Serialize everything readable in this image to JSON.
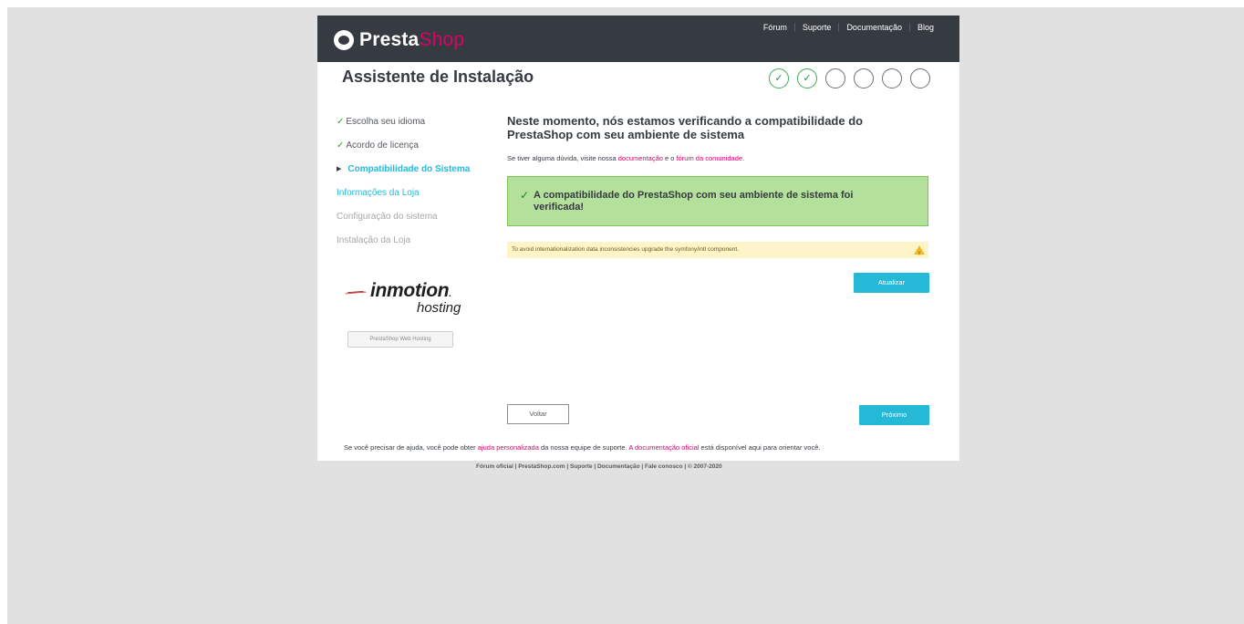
{
  "header": {
    "logo_presta": "Presta",
    "logo_shop": "Shop",
    "nav": [
      "Fórum",
      "Suporte",
      "Documentação",
      "Blog"
    ]
  },
  "title": "Assistente de Instalação",
  "steps": [
    {
      "state": "done",
      "symbol": "✓"
    },
    {
      "state": "done",
      "symbol": "✓"
    },
    {
      "state": "todo",
      "symbol": ""
    },
    {
      "state": "todo",
      "symbol": ""
    },
    {
      "state": "todo",
      "symbol": ""
    },
    {
      "state": "todo",
      "symbol": ""
    }
  ],
  "sidebar": {
    "items": [
      {
        "label": "Escolha seu idioma",
        "state": "done"
      },
      {
        "label": "Acordo de licença",
        "state": "done"
      },
      {
        "label": "Compatibilidade do Sistema",
        "state": "active"
      },
      {
        "label": "Informações da Loja",
        "state": "next"
      },
      {
        "label": "Configuração do sistema",
        "state": "todo"
      },
      {
        "label": "Instalação da Loja",
        "state": "todo"
      }
    ],
    "sponsor_word": "inmotion",
    "sponsor_sub": "hosting",
    "sponsor_button": "PrestaShop Web Hosting"
  },
  "main": {
    "heading": "Neste momento, nós estamos verificando a compatibilidade do PrestaShop com seu ambiente de sistema",
    "info_prefix": "Se tiver alguma dúvida, visite nossa ",
    "info_link1": "documentação",
    "info_mid": " e o ",
    "info_link2": "fórum da comunidade",
    "info_suffix": ".",
    "success_message": "A compatibilidade do PrestaShop com seu ambiente de sistema foi verificada!",
    "warning_message": "To avoid internationalization data inconsistencies upgrade the symfony/intl component.",
    "update_button": "Atualizar",
    "back_button": "Voltar",
    "next_button": "Próximo"
  },
  "help": {
    "prefix": "Se você precisar de ajuda, você pode obter ",
    "link1": "ajuda personalizada",
    "mid": " da nossa equipe de suporte. ",
    "link2": "A documentação oficial",
    "suffix": " está disponível aqui para orientar você."
  },
  "footer": "Fórum oficial | PrestaShop.com | Suporte | Documentação | Fale conosco | © 2007-2020",
  "colors": {
    "brand_pink": "#df0067",
    "accent_blue": "#25b9d7",
    "success_green": "#b3e09a",
    "header_dark": "#363a41"
  }
}
